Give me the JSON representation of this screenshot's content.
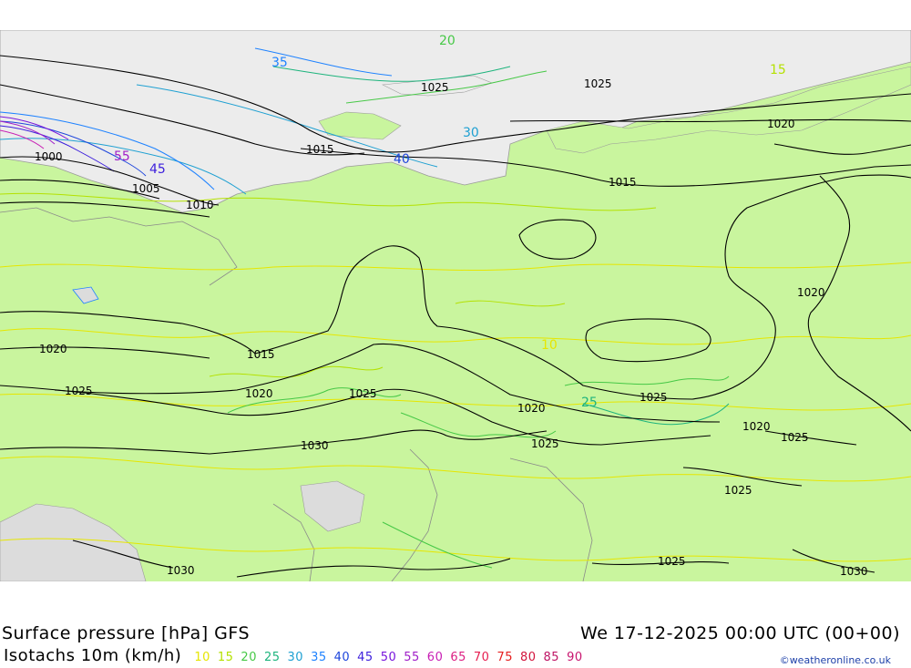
{
  "title": {
    "product": "Surface pressure [hPa] GFS",
    "datetime": "We 17-12-2025 00:00 UTC (00+00)"
  },
  "subtitle": {
    "label": "Isotachs 10m (km/h)"
  },
  "legend": {
    "items": [
      {
        "value": "10",
        "color": "#e6e600"
      },
      {
        "value": "15",
        "color": "#b4e100"
      },
      {
        "value": "20",
        "color": "#46c846"
      },
      {
        "value": "25",
        "color": "#1eb47d"
      },
      {
        "value": "30",
        "color": "#1ea0d2"
      },
      {
        "value": "35",
        "color": "#1e82ff"
      },
      {
        "value": "40",
        "color": "#1e46dc"
      },
      {
        "value": "45",
        "color": "#3c1edc"
      },
      {
        "value": "50",
        "color": "#7814dc"
      },
      {
        "value": "55",
        "color": "#a01ec8"
      },
      {
        "value": "60",
        "color": "#c81eb4"
      },
      {
        "value": "65",
        "color": "#dc1e82"
      },
      {
        "value": "70",
        "color": "#e61e50"
      },
      {
        "value": "75",
        "color": "#e61e1e"
      },
      {
        "value": "80",
        "color": "#d2143c"
      },
      {
        "value": "85",
        "color": "#be1464"
      },
      {
        "value": "90",
        "color": "#c8146e"
      }
    ]
  },
  "isobar_labels": [
    "1000",
    "1005",
    "1010",
    "1015",
    "1015",
    "1015",
    "1020",
    "1020",
    "1020",
    "1020",
    "1020",
    "1020",
    "1025",
    "1025",
    "1025",
    "1025",
    "1025",
    "1025",
    "1025",
    "1025",
    "1025",
    "1030",
    "1030",
    "1030"
  ],
  "isotach_labels": [
    "10",
    "15",
    "20",
    "25",
    "30",
    "35",
    "40",
    "45",
    "55"
  ],
  "colors": {
    "land": "#c9f59e",
    "sea": "#ececec",
    "isobar": "#000000"
  },
  "credit": "©weatheronline.co.uk"
}
